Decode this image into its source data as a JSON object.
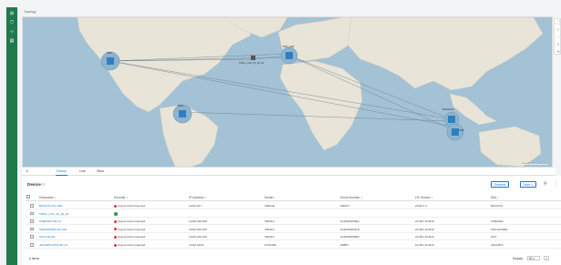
{
  "breadcrumb": "Topology",
  "rail_icons": [
    "grid-icon",
    "shield-icon",
    "network-icon",
    "list-icon"
  ],
  "map": {
    "sites": [
      {
        "label": "SFO",
        "kind": "cluster"
      },
      {
        "label": "PAR_LAB",
        "kind": "cluster"
      },
      {
        "label": "TRIAL_LOC_01_02_01",
        "kind": "device"
      },
      {
        "label": "BOG",
        "kind": "cluster"
      },
      {
        "label": "BANGKOK",
        "kind": "cluster"
      },
      {
        "label": "SUB",
        "kind": "cluster"
      }
    ],
    "attribution": "Map data ©2023 | Terms of Use"
  },
  "tabs": [
    {
      "label": "Device"
    },
    {
      "label": "Link"
    },
    {
      "label": "Sites"
    }
  ],
  "table": {
    "title": "Device",
    "count_badge": "0",
    "buttons": {
      "deselect": "Deselect",
      "more": "More ∨"
    },
    "columns": [
      "Hostname ↕",
      "Severity ↕",
      "IP Address ↕",
      "Model ↕",
      "Serial Number ↕",
      "OS Version ↕",
      "Site ↕"
    ],
    "rows": [
      {
        "hostname": "BOGOTA-HQ-SD1",
        "severity": "Urgent Action Needed",
        "sev": "critical",
        "ip": "10.80.18.7",
        "model": "VEDGE",
        "serial": "SRDSY",
        "os": "20.09.1.3",
        "site": "BOGOTA"
      },
      {
        "hostname": "TRIAL_LOC_01_02_01",
        "severity": "",
        "sev": "ok",
        "ip": "",
        "model": "",
        "serial": "",
        "os": "",
        "site": ""
      },
      {
        "hostname": "CHENNAI-SD-C1",
        "severity": "Urgent Action Needed",
        "sev": "critical",
        "ip": "10.80.160.209",
        "model": "ISR4K4",
        "serial": "FLM2304H3EA",
        "os": "23.4R1.10-B10",
        "site": "CHENNAI"
      },
      {
        "hostname": "SINGAPORE-SD-C01",
        "severity": "Urgent Action Needed",
        "sev": "critical",
        "ip": "10.80.160.203",
        "model": "ISR4K4",
        "serial": "FLM2304H41N",
        "os": "23.4R1.10-B10",
        "site": "SINGAPORE"
      },
      {
        "hostname": "SFO-HQ-SD",
        "severity": "Urgent Action Needed",
        "sev": "critical",
        "ip": "10.80.160.220",
        "model": "ISR4K4",
        "serial": "FLM2304H9E0",
        "os": "23.4R1.10-B10",
        "site": "SFO"
      },
      {
        "hostname": "JAKARTA-RTR-SD-C1",
        "severity": "Urgent Action Needed",
        "sev": "critical",
        "ip": "10.80.160.8",
        "model": "FTD1020",
        "serial": "9DB57",
        "os": "23.4R1.10-B10",
        "site": "JAKARTA"
      }
    ],
    "footer": {
      "items": "6 Items",
      "display_label": "Display",
      "display_value": "50 ∨",
      "page": "1"
    }
  },
  "colors": {
    "accent": "#1a73d9",
    "rail": "#1f7a4c",
    "critical": "#d9363e",
    "ok": "#1f9d55"
  }
}
